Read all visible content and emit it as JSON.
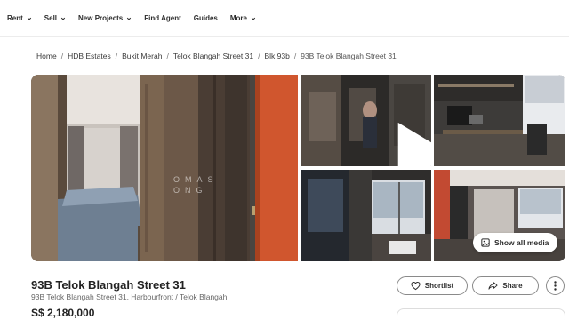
{
  "nav": {
    "items": [
      {
        "label": "Rent",
        "dropdown": true
      },
      {
        "label": "Sell",
        "dropdown": true
      },
      {
        "label": "New Projects",
        "dropdown": true
      },
      {
        "label": "Find Agent",
        "dropdown": false
      },
      {
        "label": "Guides",
        "dropdown": false
      },
      {
        "label": "More",
        "dropdown": true
      }
    ]
  },
  "breadcrumb": {
    "items": [
      "Home",
      "HDB Estates",
      "Bukit Merah",
      "Telok Blangah Street 31",
      "Blk 93b",
      "93B Telok Blangah Street 31"
    ]
  },
  "gallery": {
    "watermark": "OMAS\nONG",
    "show_all_label": "Show all media",
    "icons": {
      "play": "play-icon",
      "media": "image-icon"
    }
  },
  "listing": {
    "title": "93B Telok Blangah Street 31",
    "address": "93B Telok Blangah Street 31, Harbourfront / Telok Blangah",
    "price": "S$ 2,180,000"
  },
  "actions": {
    "shortlist_label": "Shortlist",
    "share_label": "Share",
    "icons": {
      "shortlist": "heart-icon",
      "share": "share-arrow-icon",
      "more": "more-vertical-icon"
    }
  },
  "colors": {
    "accent": "#e04e2a",
    "text": "#2c2c2c",
    "muted": "#666666",
    "border": "#8a8a8a"
  }
}
